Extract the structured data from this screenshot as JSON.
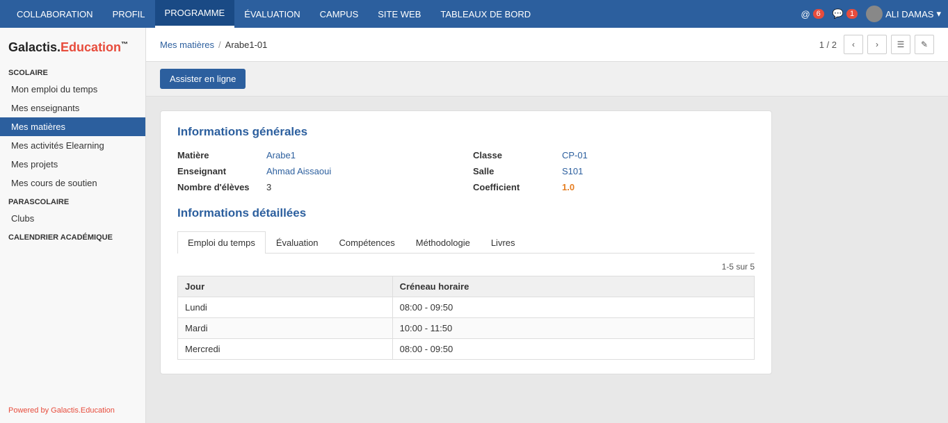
{
  "nav": {
    "items": [
      {
        "label": "COLLABORATION",
        "active": false
      },
      {
        "label": "PROFIL",
        "active": false
      },
      {
        "label": "PROGRAMME",
        "active": true
      },
      {
        "label": "ÉVALUATION",
        "active": false
      },
      {
        "label": "CAMPUS",
        "active": false
      },
      {
        "label": "SITE WEB",
        "active": false
      },
      {
        "label": "TABLEAUX DE BORD",
        "active": false
      }
    ],
    "notifications_count": "6",
    "messages_count": "1",
    "user_name": "ALI DAMAS"
  },
  "sidebar": {
    "logo_black": "Galactis.",
    "logo_red": "Education",
    "logo_tm": "™",
    "sections": [
      {
        "title": "SCOLAIRE",
        "items": [
          {
            "label": "Mon emploi du temps",
            "active": false
          },
          {
            "label": "Mes enseignants",
            "active": false
          },
          {
            "label": "Mes matières",
            "active": true
          },
          {
            "label": "Mes activités Elearning",
            "active": false
          },
          {
            "label": "Mes projets",
            "active": false
          },
          {
            "label": "Mes cours de soutien",
            "active": false
          }
        ]
      },
      {
        "title": "PARASCOLAIRE",
        "items": [
          {
            "label": "Clubs",
            "active": false
          }
        ]
      },
      {
        "title": "CALENDRIER ACADÉMIQUE",
        "items": []
      }
    ],
    "footer": "Powered by Galactis.Education"
  },
  "breadcrumb": {
    "parent_label": "Mes matières",
    "separator": "/",
    "current": "Arabe1-01"
  },
  "pagination": {
    "info": "1 / 2"
  },
  "action_bar": {
    "button_label": "Assister en ligne"
  },
  "general_info": {
    "section_title": "Informations générales",
    "fields": [
      {
        "label": "Matière",
        "value": "Arabe1",
        "type": "link"
      },
      {
        "label": "Classe",
        "value": "CP-01",
        "type": "link"
      },
      {
        "label": "Enseignant",
        "value": "Ahmad Aissaoui",
        "type": "link"
      },
      {
        "label": "Salle",
        "value": "S101",
        "type": "link"
      },
      {
        "label": "Nombre d'élèves",
        "value": "3",
        "type": "plain"
      },
      {
        "label": "Coefficient",
        "value": "1.0",
        "type": "highlight"
      }
    ]
  },
  "detailed_info": {
    "section_title": "Informations détaillées",
    "tabs": [
      {
        "label": "Emploi du temps",
        "active": true
      },
      {
        "label": "Évaluation",
        "active": false
      },
      {
        "label": "Compétences",
        "active": false
      },
      {
        "label": "Méthodologie",
        "active": false
      },
      {
        "label": "Livres",
        "active": false
      }
    ],
    "table": {
      "pagination_info": "1-5 sur 5",
      "columns": [
        "Jour",
        "Créneau horaire"
      ],
      "rows": [
        {
          "jour": "Lundi",
          "creneau": "08:00 - 09:50"
        },
        {
          "jour": "Mardi",
          "creneau": "10:00 - 11:50"
        },
        {
          "jour": "Mercredi",
          "creneau": "08:00 - 09:50"
        }
      ]
    }
  }
}
